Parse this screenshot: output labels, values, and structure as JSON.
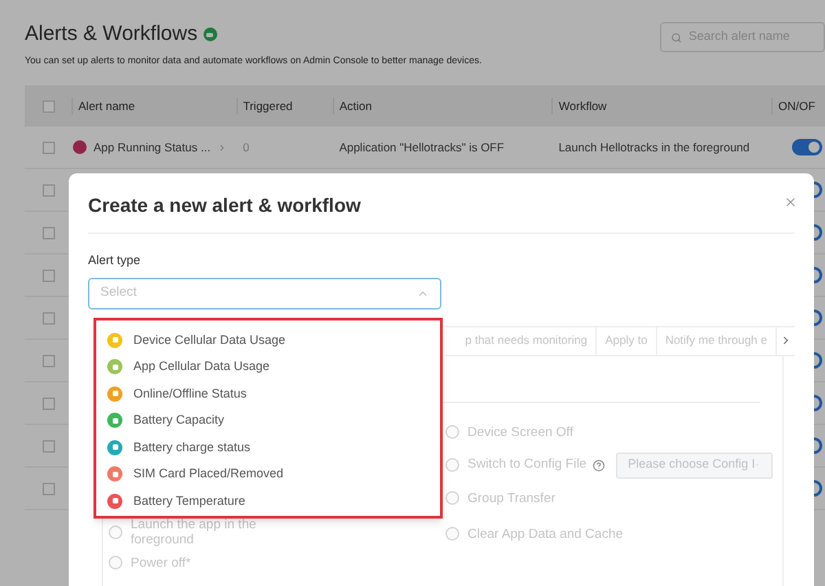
{
  "page": {
    "title": "Alerts & Workflows",
    "subtitle": "You can set up alerts to monitor data and automate workflows on Admin Console to better manage devices.",
    "search": {
      "placeholder": "Search alert name"
    }
  },
  "table": {
    "columns": [
      "Alert name",
      "Triggered",
      "Action",
      "Workflow",
      "ON/OF"
    ],
    "all_checked": false,
    "rows": [
      {
        "checked": false,
        "name": "App Running Status ...",
        "triggered": "0",
        "action": "Application \"Hellotracks\" is OFF",
        "workflow": "Launch Hellotracks in the foreground",
        "on": true
      },
      {
        "checked": false,
        "on": true
      },
      {
        "checked": false,
        "on": true
      },
      {
        "checked": false,
        "on": true
      },
      {
        "checked": false,
        "on": true
      },
      {
        "checked": false,
        "on": true
      },
      {
        "checked": false,
        "on": true
      },
      {
        "checked": false,
        "on": true
      },
      {
        "checked": false,
        "on": true
      }
    ]
  },
  "modal": {
    "title": "Create a new alert & workflow",
    "alert_type": {
      "label": "Alert type",
      "placeholder": "Select",
      "expanded": true,
      "options": [
        {
          "label": "Device Cellular Data Usage",
          "color": "#f5c21b"
        },
        {
          "label": "App Cellular Data Usage",
          "color": "#9bc55a"
        },
        {
          "label": "Online/Offline Status",
          "color": "#f0a024"
        },
        {
          "label": "Battery Capacity",
          "color": "#3db85a"
        },
        {
          "label": "Battery charge status",
          "color": "#27a9b8"
        },
        {
          "label": "SIM Card Placed/Removed",
          "color": "#ee7a66"
        },
        {
          "label": "Battery Temperature",
          "color": "#ef5156"
        }
      ]
    },
    "tabs": [
      {
        "label": "p that needs monitoring",
        "selected": false
      },
      {
        "label": "Apply to",
        "selected": false
      },
      {
        "label": "Notify me through e",
        "selected": false
      }
    ],
    "left_actions": [
      {
        "label": "Launch the app in the foreground",
        "kind": "radio",
        "disabled": true,
        "selected": false
      },
      {
        "label": "Power off*",
        "kind": "radio",
        "disabled": true,
        "selected": false
      }
    ],
    "right_actions": [
      {
        "label": "Device Screen Off",
        "kind": "radio",
        "disabled": true,
        "selected": false
      },
      {
        "label": "Switch to Config File",
        "kind": "config",
        "disabled": true,
        "selected": false,
        "placeholder": "Please choose Config I"
      },
      {
        "label": "Group Transfer",
        "kind": "radio",
        "disabled": true,
        "selected": false
      },
      {
        "label": "Clear App Data and Cache",
        "kind": "radio",
        "disabled": true,
        "selected": false
      }
    ]
  }
}
